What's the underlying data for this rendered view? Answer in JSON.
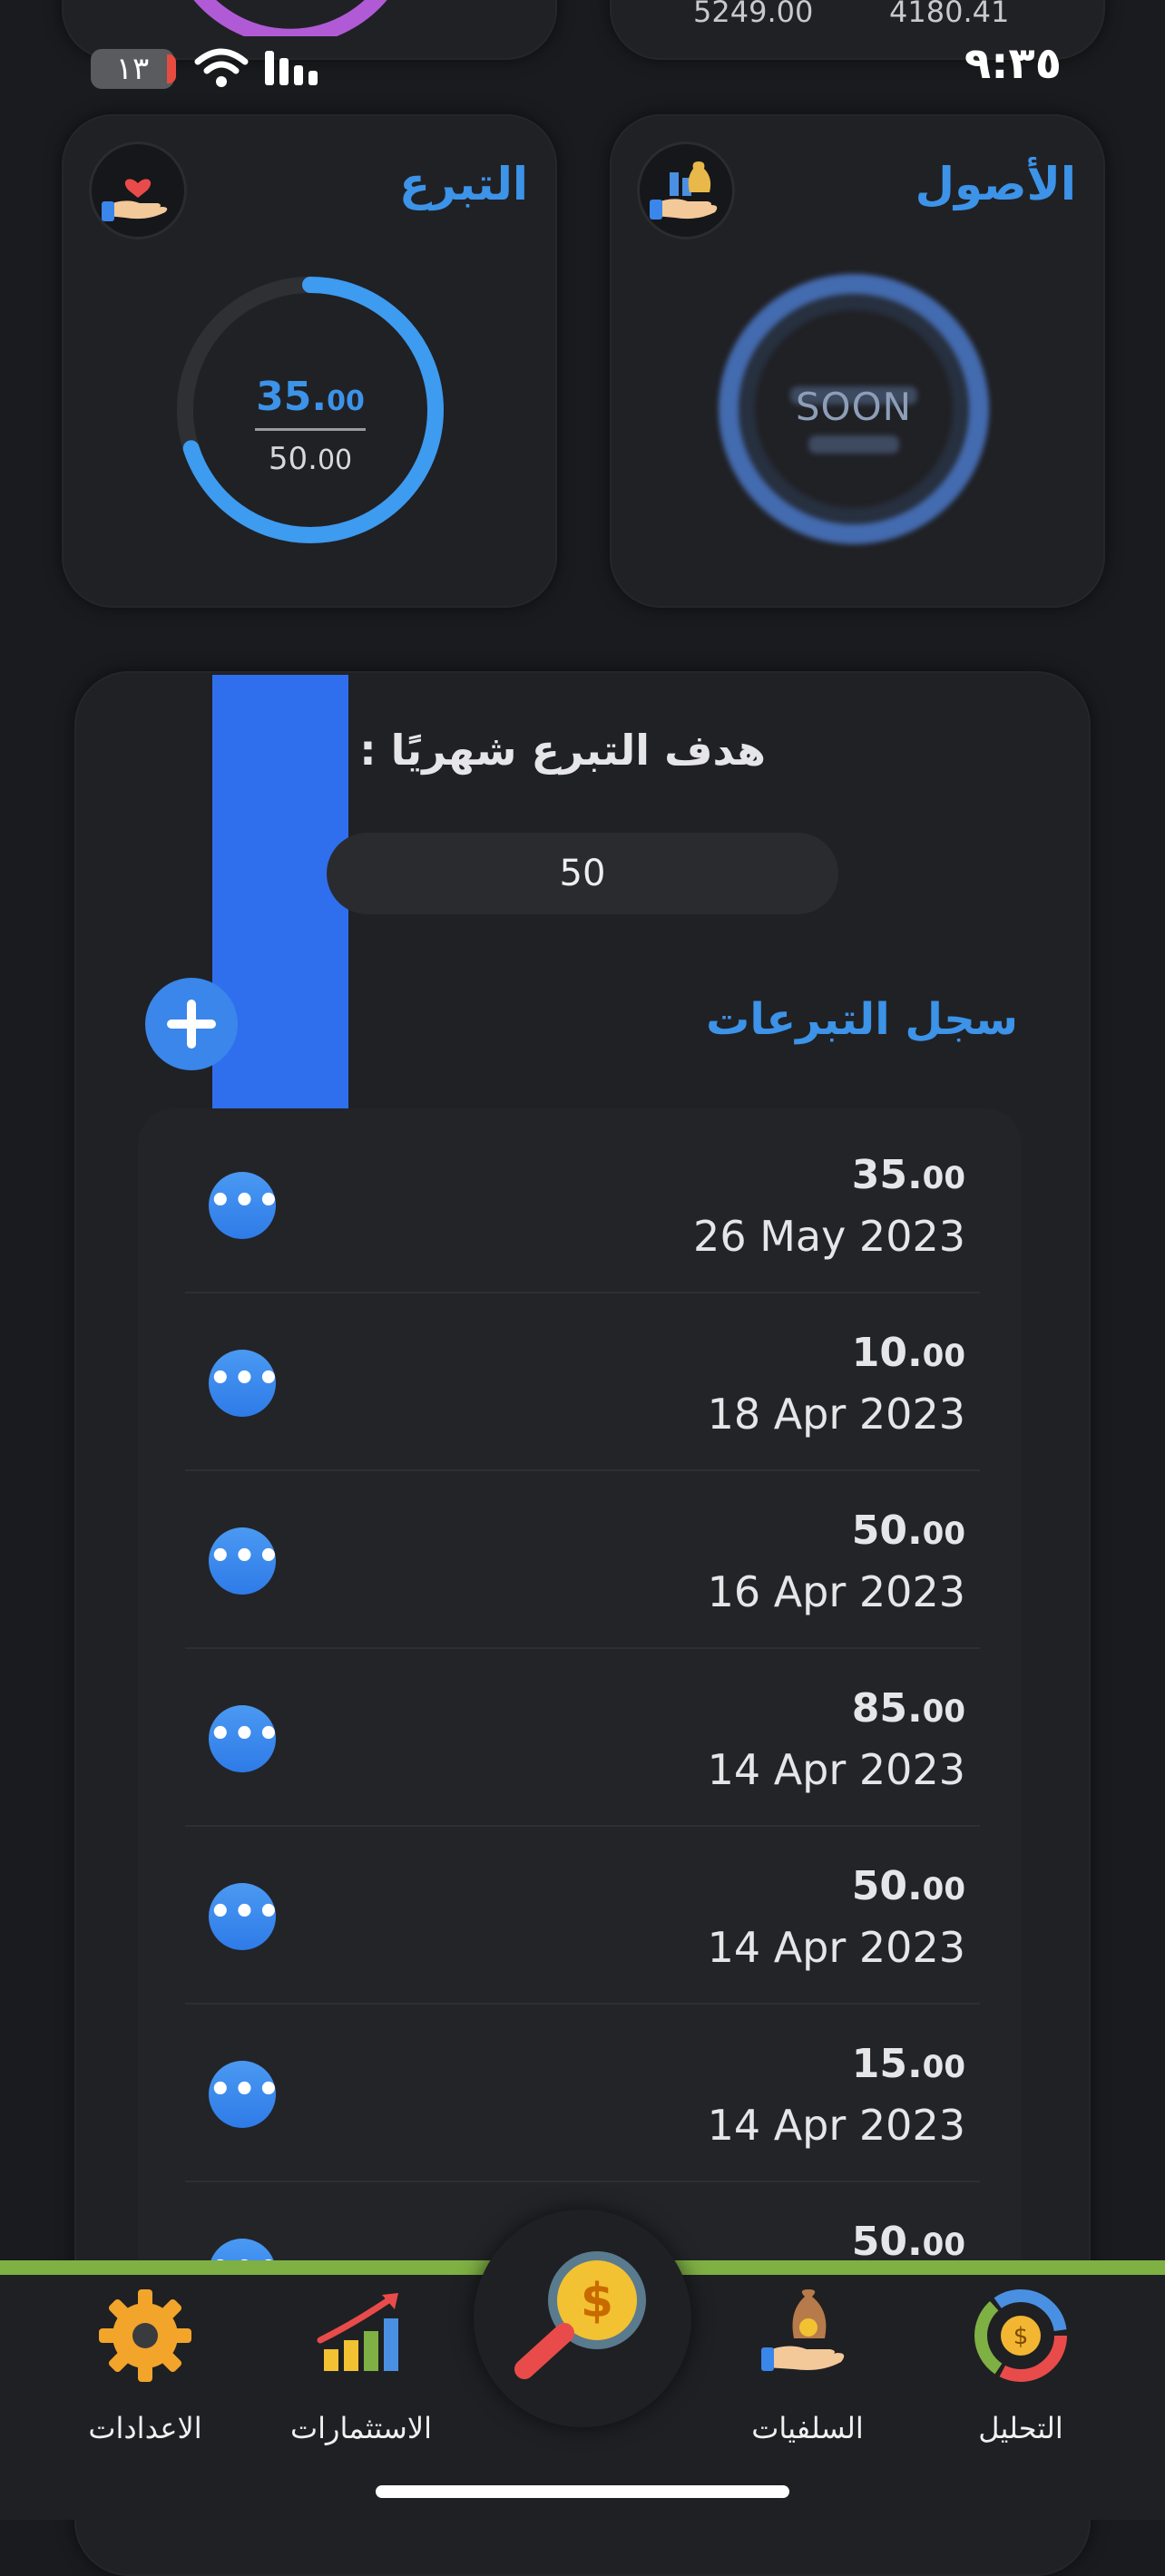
{
  "status_bar": {
    "time": "٩:٣٥",
    "battery": "١٣"
  },
  "top_values": {
    "left": "5249.00",
    "right": "4180.41"
  },
  "assets_card": {
    "title": "الأصول",
    "center_label": "SOON",
    "icon": "hand-money-bag-icon"
  },
  "donation_card": {
    "title": "التبرع",
    "amount_main": "35.",
    "amount_main_dec": "00",
    "goal_main": "50.",
    "goal_main_dec": "00",
    "progress_fraction": 0.7,
    "icon": "hand-heart-icon"
  },
  "goal": {
    "label": "هدف التبرع شهريًا :",
    "value": "50"
  },
  "history": {
    "title": "سجل التبرعات",
    "rows": [
      {
        "amount": "35.",
        "dec": "00",
        "date": "26 May 2023"
      },
      {
        "amount": "10.",
        "dec": "00",
        "date": "18 Apr 2023"
      },
      {
        "amount": "50.",
        "dec": "00",
        "date": "16 Apr 2023"
      },
      {
        "amount": "85.",
        "dec": "00",
        "date": "14 Apr 2023"
      },
      {
        "amount": "50.",
        "dec": "00",
        "date": "14 Apr 2023"
      },
      {
        "amount": "15.",
        "dec": "00",
        "date": "14 Apr 2023"
      },
      {
        "amount": "50.",
        "dec": "00",
        "date": ""
      }
    ],
    "more_symbol": "•••"
  },
  "tabbar": {
    "analysis": "التحليل",
    "loans": "السلفيات",
    "investments": "الاستثمارات",
    "settings": "الاعدادات"
  },
  "colors": {
    "accent": "#3c93e8",
    "button": "#3a86ea",
    "tab_line": "#7eb044"
  }
}
